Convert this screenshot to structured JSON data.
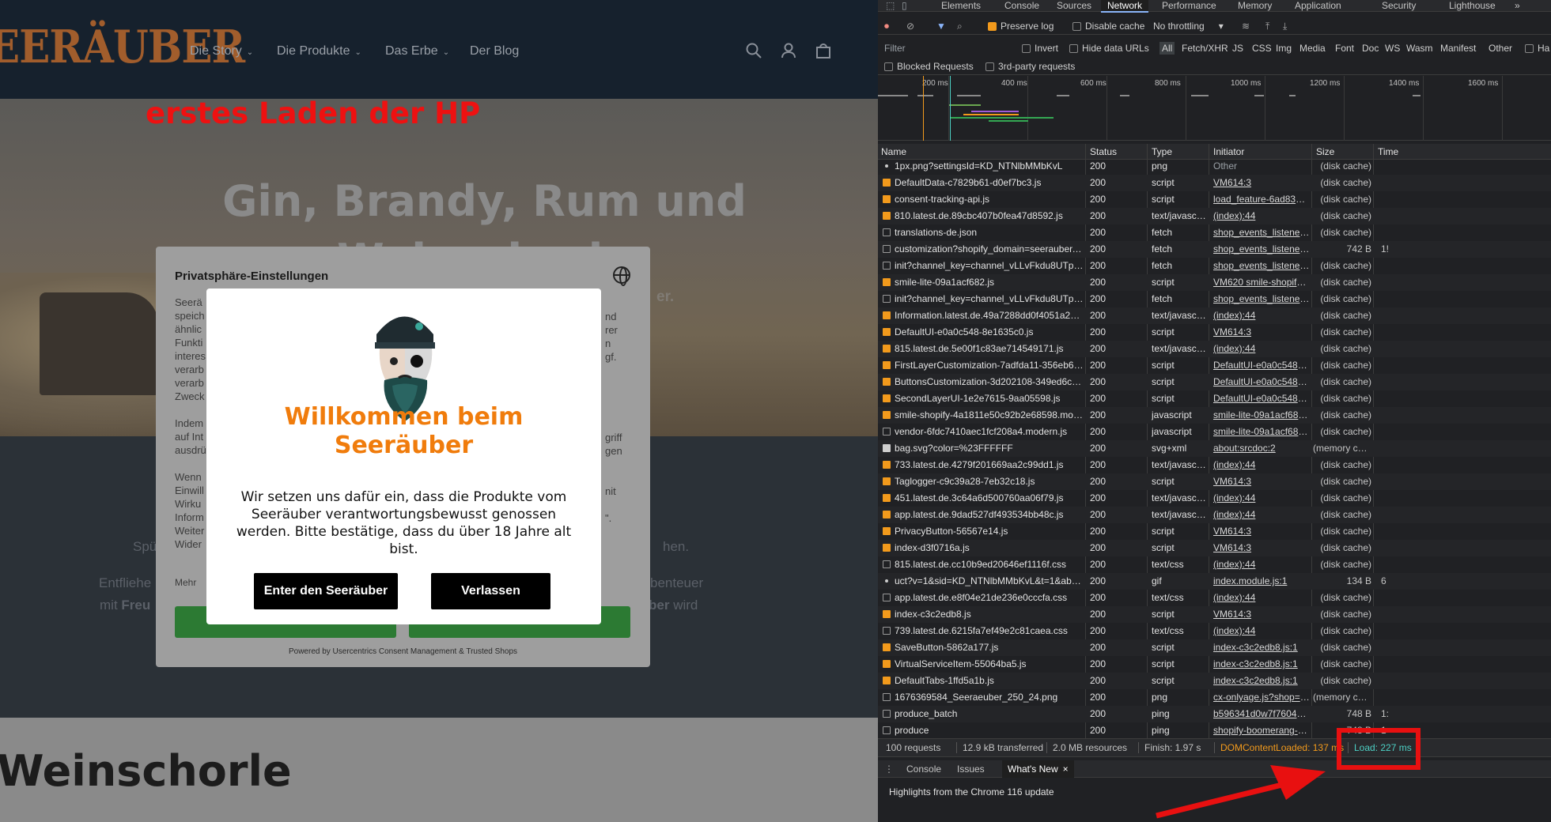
{
  "site": {
    "logo": "EERÄUBER",
    "nav": [
      "Die Story",
      "Die Produkte",
      "Das Erbe",
      "Der Blog"
    ],
    "nav_chevron": "⌄",
    "annotation": "erstes Laden der HP",
    "hero_title_line1": "Gin, Brandy, Rum und",
    "hero_title_line2": "Weinschorle",
    "hero_sub": "er.",
    "mid_lines": [
      {
        "left": "Spü",
        "right": "hen."
      },
      {
        "left": "Entfliehe",
        "right": "benteuer"
      },
      {
        "left_a": "mit ",
        "left_b": "Freu",
        "right_a": "ber",
        "right_b": " wird"
      }
    ],
    "bottom_title": "Weinschorle"
  },
  "privacy": {
    "title": "Privatsphäre-Einstellungen",
    "left_fragments": [
      "Seerä",
      "speich",
      "ähnlic",
      "Funkti",
      "interes",
      "verarb",
      "verarb",
      "Zweck",
      "",
      "Indem",
      "auf Int",
      "ausdrü",
      "",
      "Wenn",
      "Einwill",
      "Wirku",
      "Inform",
      "Weiter",
      "Wider"
    ],
    "right_fragments": [
      "nd",
      "rer",
      "n",
      "gf.",
      "",
      "",
      "",
      "",
      "",
      "griff",
      "gen",
      "",
      "",
      "nit",
      "",
      "\".",
      "",
      "",
      ""
    ],
    "more": "Mehr",
    "footer": "Powered by Usercentrics Consent Management & Trusted Shops"
  },
  "age_gate": {
    "title_line1": "Willkommen beim",
    "title_line2": "Seeräuber",
    "text": "Wir setzen uns dafür ein, dass die Produkte vom Seeräuber verantwortungsbewusst genossen werden. Bitte bestätige, dass du über 18 Jahre alt bist.",
    "enter_label": "Enter den Seeräuber",
    "leave_label": "Verlassen",
    "accent": "#f07c0c"
  },
  "devtools": {
    "tabs": [
      "Elements",
      "Console",
      "Sources",
      "Network",
      "Performance",
      "Memory",
      "Application",
      "Security",
      "Lighthouse"
    ],
    "active_tab": "Network",
    "more_tabs": "»",
    "toolbar": {
      "preserve_log": "Preserve log",
      "disable_cache": "Disable cache",
      "throttling": "No throttling"
    },
    "filter": {
      "placeholder": "Filter",
      "invert": "Invert",
      "hide_data_urls": "Hide data URLs",
      "types": [
        "All",
        "Fetch/XHR",
        "JS",
        "CSS",
        "Img",
        "Media",
        "Font",
        "Doc",
        "WS",
        "Wasm",
        "Manifest",
        "Other"
      ],
      "has_blocked": "Ha",
      "blocked_requests": "Blocked Requests",
      "third_party": "3rd-party requests"
    },
    "timeline_ticks": [
      "200 ms",
      "400 ms",
      "600 ms",
      "800 ms",
      "1000 ms",
      "1200 ms",
      "1400 ms",
      "1600 ms"
    ],
    "columns": [
      "Name",
      "Status",
      "Type",
      "Initiator",
      "Size",
      "Time"
    ],
    "rows": [
      {
        "name": "1px.png?settingsId=KD_NTNlbMMbKvL",
        "icon": "dot",
        "status": "200",
        "type": "png",
        "initiator": "Other",
        "link": false,
        "size": "(disk cache)",
        "time": ""
      },
      {
        "name": "DefaultData-c7829b61-d0ef7bc3.js",
        "icon": "script",
        "status": "200",
        "type": "script",
        "initiator": "VM614:3",
        "link": true,
        "size": "(disk cache)",
        "time": ""
      },
      {
        "name": "consent-tracking-api.js",
        "icon": "script",
        "status": "200",
        "type": "script",
        "initiator": "load_feature-6ad832d....js:1",
        "link": true,
        "size": "(disk cache)",
        "time": ""
      },
      {
        "name": "810.latest.de.89cbc407b0fea47d8592.js",
        "icon": "script",
        "status": "200",
        "type": "text/javascript",
        "initiator": "(index):44",
        "link": true,
        "size": "(disk cache)",
        "time": ""
      },
      {
        "name": "translations-de.json",
        "icon": "plain",
        "status": "200",
        "type": "fetch",
        "initiator": "shop_events_listener-65c...",
        "link": true,
        "size": "(disk cache)",
        "time": ""
      },
      {
        "name": "customization?shopify_domain=seerauber.myshopify....",
        "icon": "plain",
        "status": "200",
        "type": "fetch",
        "initiator": "shop_events_listener-65c...",
        "link": true,
        "size": "742 B",
        "time": "1!"
      },
      {
        "name": "init?channel_key=channel_vLLvFkdu8UTppX47D43g...",
        "icon": "plain",
        "status": "200",
        "type": "fetch",
        "initiator": "shop_events_listener-65c...",
        "link": true,
        "size": "(disk cache)",
        "time": ""
      },
      {
        "name": "smile-lite-09a1acf682.js",
        "icon": "script",
        "status": "200",
        "type": "script",
        "initiator": "VM620 smile-shopify.js:1",
        "link": true,
        "size": "(disk cache)",
        "time": ""
      },
      {
        "name": "init?channel_key=channel_vLLvFkdu8UTppX47D43g...",
        "icon": "plain",
        "status": "200",
        "type": "fetch",
        "initiator": "shop_events_listener-65c...",
        "link": true,
        "size": "(disk cache)",
        "time": ""
      },
      {
        "name": "Information.latest.de.49a7288dd0f4051a2da9.js",
        "icon": "script",
        "status": "200",
        "type": "text/javascript",
        "initiator": "(index):44",
        "link": true,
        "size": "(disk cache)",
        "time": ""
      },
      {
        "name": "DefaultUI-e0a0c548-8e1635c0.js",
        "icon": "script",
        "status": "200",
        "type": "script",
        "initiator": "VM614:3",
        "link": true,
        "size": "(disk cache)",
        "time": ""
      },
      {
        "name": "815.latest.de.5e00f1c83ae714549171.js",
        "icon": "script",
        "status": "200",
        "type": "text/javascript",
        "initiator": "(index):44",
        "link": true,
        "size": "(disk cache)",
        "time": ""
      },
      {
        "name": "FirstLayerCustomization-7adfda11-356eb621.js",
        "icon": "script",
        "status": "200",
        "type": "script",
        "initiator": "DefaultUI-e0a0c548-8e16...",
        "link": true,
        "size": "(disk cache)",
        "time": ""
      },
      {
        "name": "ButtonsCustomization-3d202108-349ed6cf.js",
        "icon": "script",
        "status": "200",
        "type": "script",
        "initiator": "DefaultUI-e0a0c548-8e16...",
        "link": true,
        "size": "(disk cache)",
        "time": ""
      },
      {
        "name": "SecondLayerUI-1e2e7615-9aa05598.js",
        "icon": "script",
        "status": "200",
        "type": "script",
        "initiator": "DefaultUI-e0a0c548-8e16...",
        "link": true,
        "size": "(disk cache)",
        "time": ""
      },
      {
        "name": "smile-shopify-4a1811e50c92b2e68598.modern.js",
        "icon": "script",
        "status": "200",
        "type": "javascript",
        "initiator": "smile-lite-09a1acf682.js:1",
        "link": true,
        "size": "(disk cache)",
        "time": ""
      },
      {
        "name": "vendor-6fdc7410aec1fcf208a4.modern.js",
        "icon": "plain",
        "status": "200",
        "type": "javascript",
        "initiator": "smile-lite-09a1acf682.js:1",
        "link": true,
        "size": "(disk cache)",
        "time": ""
      },
      {
        "name": "bag.svg?color=%23FFFFFF",
        "icon": "img",
        "status": "200",
        "type": "svg+xml",
        "initiator": "about:srcdoc:2",
        "link": true,
        "size": "(memory cache)",
        "time": ""
      },
      {
        "name": "733.latest.de.4279f201669aa2c99dd1.js",
        "icon": "script",
        "status": "200",
        "type": "text/javascript",
        "initiator": "(index):44",
        "link": true,
        "size": "(disk cache)",
        "time": ""
      },
      {
        "name": "Taglogger-c9c39a28-7eb32c18.js",
        "icon": "script",
        "status": "200",
        "type": "script",
        "initiator": "VM614:3",
        "link": true,
        "size": "(disk cache)",
        "time": ""
      },
      {
        "name": "451.latest.de.3c64a6d500760aa06f79.js",
        "icon": "script",
        "status": "200",
        "type": "text/javascript",
        "initiator": "(index):44",
        "link": true,
        "size": "(disk cache)",
        "time": ""
      },
      {
        "name": "app.latest.de.9dad527df493534bb48c.js",
        "icon": "script",
        "status": "200",
        "type": "text/javascript",
        "initiator": "(index):44",
        "link": true,
        "size": "(disk cache)",
        "time": ""
      },
      {
        "name": "PrivacyButton-56567e14.js",
        "icon": "script",
        "status": "200",
        "type": "script",
        "initiator": "VM614:3",
        "link": true,
        "size": "(disk cache)",
        "time": ""
      },
      {
        "name": "index-d3f0716a.js",
        "icon": "script",
        "status": "200",
        "type": "script",
        "initiator": "VM614:3",
        "link": true,
        "size": "(disk cache)",
        "time": ""
      },
      {
        "name": "815.latest.de.cc10b9ed20646ef1116f.css",
        "icon": "plain",
        "status": "200",
        "type": "text/css",
        "initiator": "(index):44",
        "link": true,
        "size": "(disk cache)",
        "time": ""
      },
      {
        "name": "uct?v=1&sid=KD_NTNlbMMbKvL&t=1&abv=&r=https...",
        "icon": "dot",
        "status": "200",
        "type": "gif",
        "initiator": "index.module.js:1",
        "link": true,
        "size": "134 B",
        "time": "6"
      },
      {
        "name": "app.latest.de.e8f04e21de236e0cccfa.css",
        "icon": "plain",
        "status": "200",
        "type": "text/css",
        "initiator": "(index):44",
        "link": true,
        "size": "(disk cache)",
        "time": ""
      },
      {
        "name": "index-c3c2edb8.js",
        "icon": "script",
        "status": "200",
        "type": "script",
        "initiator": "VM614:3",
        "link": true,
        "size": "(disk cache)",
        "time": ""
      },
      {
        "name": "739.latest.de.6215fa7ef49e2c81caea.css",
        "icon": "plain",
        "status": "200",
        "type": "text/css",
        "initiator": "(index):44",
        "link": true,
        "size": "(disk cache)",
        "time": ""
      },
      {
        "name": "SaveButton-5862a177.js",
        "icon": "script",
        "status": "200",
        "type": "script",
        "initiator": "index-c3c2edb8.js:1",
        "link": true,
        "size": "(disk cache)",
        "time": ""
      },
      {
        "name": "VirtualServiceItem-55064ba5.js",
        "icon": "script",
        "status": "200",
        "type": "script",
        "initiator": "index-c3c2edb8.js:1",
        "link": true,
        "size": "(disk cache)",
        "time": ""
      },
      {
        "name": "DefaultTabs-1ffd5a1b.js",
        "icon": "script",
        "status": "200",
        "type": "script",
        "initiator": "index-c3c2edb8.js:1",
        "link": true,
        "size": "(disk cache)",
        "time": ""
      },
      {
        "name": "1676369584_Seeraeuber_250_24.png",
        "icon": "plain",
        "status": "200",
        "type": "png",
        "initiator": "cx-onlyage.js?shop=www....",
        "link": true,
        "size": "(memory cache)",
        "time": ""
      },
      {
        "name": "produce_batch",
        "icon": "plain",
        "status": "200",
        "type": "ping",
        "initiator": "b596341d0w7f760444pf8...",
        "link": true,
        "size": "748 B",
        "time": "1:"
      },
      {
        "name": "produce",
        "icon": "plain",
        "status": "200",
        "type": "ping",
        "initiator": "shopify-boomerang-1.0.0....",
        "link": true,
        "size": "748 B",
        "time": "1"
      }
    ],
    "summary": {
      "requests": "100 requests",
      "transferred": "12.9 kB transferred",
      "resources": "2.0 MB resources",
      "finish": "Finish: 1.97 s",
      "dom_loaded": "DOMContentLoaded: 137 ms",
      "load": "Load: 227 ms"
    },
    "drawer_tabs": [
      "Console",
      "Issues",
      "What's New"
    ],
    "drawer_active": "What's New",
    "drawer_close": "×",
    "drawer_text": "Highlights from the Chrome 116 update",
    "colors": {
      "dom_loaded": "#f29a1c",
      "load": "#4dd0c4",
      "annotation": "#e81010"
    }
  }
}
